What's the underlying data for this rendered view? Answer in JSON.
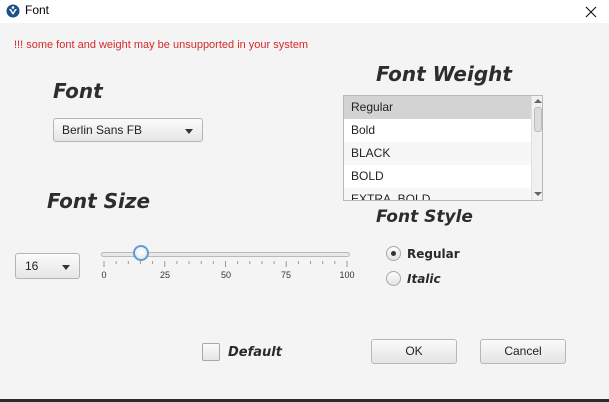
{
  "window": {
    "title": "Font",
    "icon": "app-logo-icon",
    "close_icon": "close-icon"
  },
  "warning": "!!! some font and weight may be unsupported in your system",
  "font": {
    "title": "Font",
    "selected": "Berlin Sans FB"
  },
  "font_weight": {
    "title": "Font Weight",
    "items": [
      "Regular",
      "Bold",
      "BLACK",
      "BOLD",
      "EXTRA_BOLD"
    ],
    "selected_index": 0
  },
  "font_size": {
    "title": "Font Size",
    "value": "16",
    "slider": {
      "min": 0,
      "max": 100,
      "value": 16,
      "ticks": [
        "0",
        "25",
        "50",
        "75",
        "100"
      ]
    }
  },
  "font_style": {
    "title": "Font Style",
    "options": [
      "Regular",
      "Italic"
    ],
    "selected": "Regular"
  },
  "default_checkbox": {
    "label": "Default",
    "checked": false
  },
  "buttons": {
    "ok": "OK",
    "cancel": "Cancel"
  },
  "colors": {
    "warning": "#d42a2a",
    "slider_thumb_ring": "#5a9fd8",
    "list_selection": "#d3d3d3"
  }
}
